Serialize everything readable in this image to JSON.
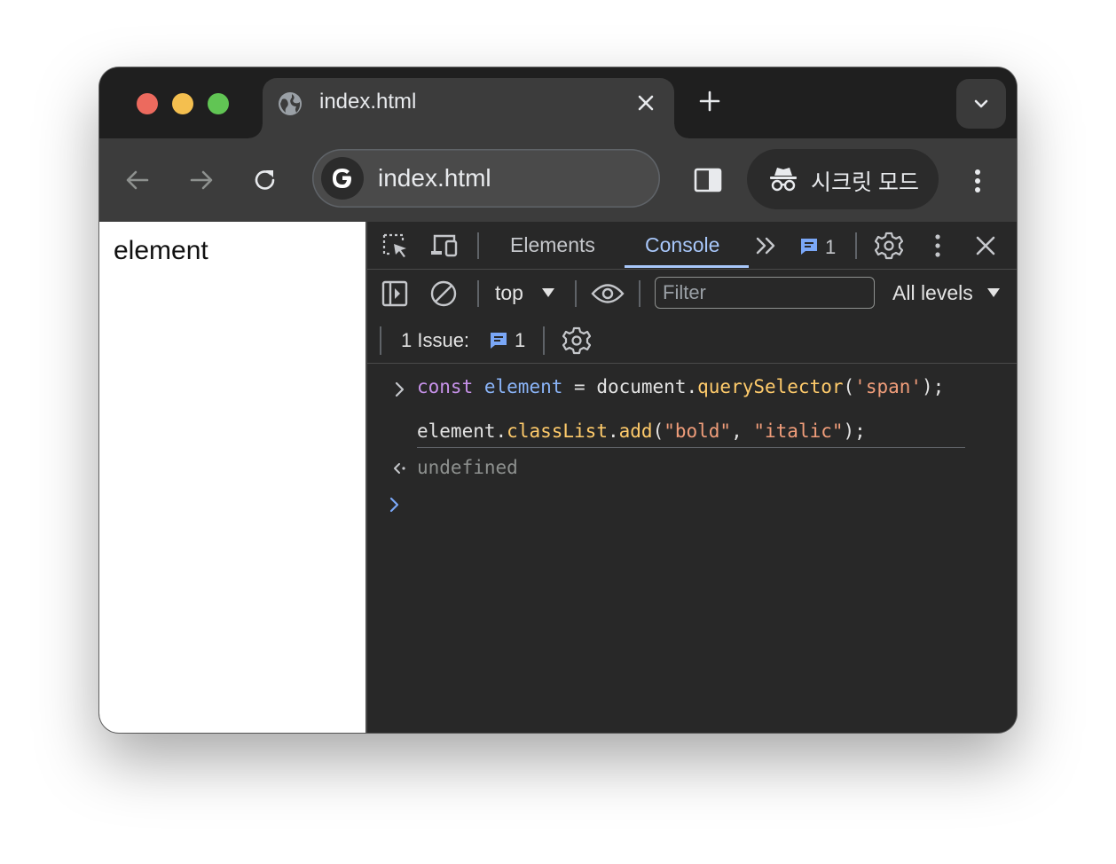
{
  "tab": {
    "title": "index.html"
  },
  "omnibox": {
    "url": "index.html"
  },
  "incognito": {
    "label": "시크릿 모드"
  },
  "page": {
    "text": "element"
  },
  "devtools": {
    "tabs": [
      "Elements",
      "Console"
    ],
    "active_tab": "Console",
    "issue_badge_count": "1",
    "console_bar": {
      "context": "top",
      "filter_placeholder": "Filter",
      "filter_value": "",
      "levels": "All levels"
    },
    "issues_bar": {
      "label": "1 Issue:",
      "count": "1"
    },
    "console": {
      "input_line1": {
        "kw": "const",
        "var": "element",
        "eq": " = ",
        "obj": "document",
        "dot": ".",
        "method": "querySelector",
        "open": "(",
        "arg": "'span'",
        "close": ");"
      },
      "input_line2": {
        "obj": "element",
        "dot1": ".",
        "prop": "classList",
        "dot2": ".",
        "method": "add",
        "open": "(",
        "arg1": "\"bold\"",
        "comma": ", ",
        "arg2": "\"italic\"",
        "close": ");"
      },
      "output": "undefined"
    }
  },
  "colors": {
    "accent": "#a8c7fa",
    "keyword": "#c792ea",
    "variable": "#8ab4f8",
    "function": "#ffcb6b",
    "string": "#f09d7a",
    "issue_icon": "#7aa7f7"
  }
}
